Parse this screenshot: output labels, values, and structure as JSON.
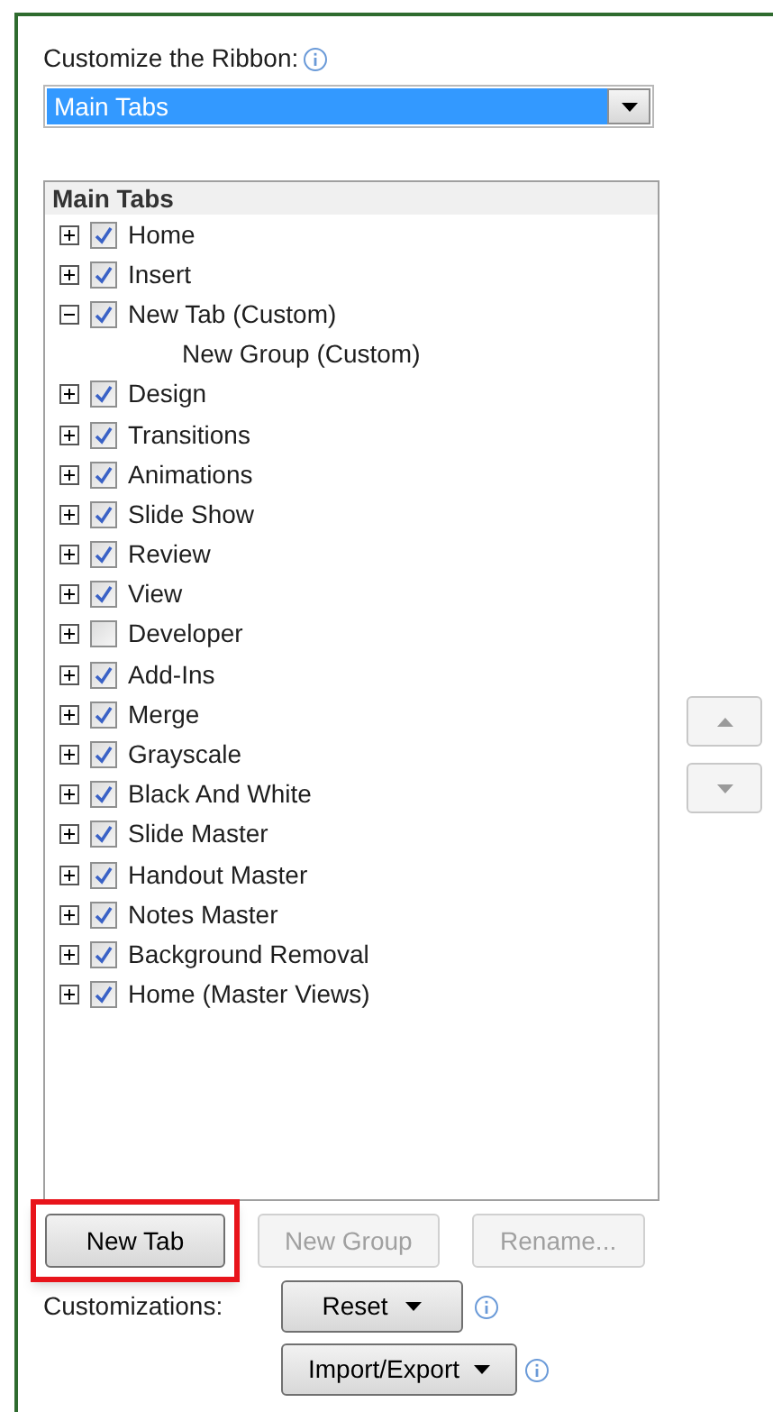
{
  "ribbon_label": "Customize the Ribbon:",
  "ribbon_select": {
    "value": "Main Tabs"
  },
  "tree": {
    "header": "Main Tabs",
    "items": [
      {
        "label": "Home",
        "checked": true,
        "expanded": false
      },
      {
        "label": "Insert",
        "checked": true,
        "expanded": false
      },
      {
        "label": "New Tab (Custom)",
        "checked": true,
        "expanded": true,
        "children": [
          {
            "label": "New Group (Custom)"
          }
        ]
      },
      {
        "label": "Design",
        "checked": true,
        "expanded": false
      },
      {
        "label": "Transitions",
        "checked": true,
        "expanded": false
      },
      {
        "label": "Animations",
        "checked": true,
        "expanded": false
      },
      {
        "label": "Slide Show",
        "checked": true,
        "expanded": false
      },
      {
        "label": "Review",
        "checked": true,
        "expanded": false
      },
      {
        "label": "View",
        "checked": true,
        "expanded": false
      },
      {
        "label": "Developer",
        "checked": false,
        "expanded": false
      },
      {
        "label": "Add-Ins",
        "checked": true,
        "expanded": false
      },
      {
        "label": "Merge",
        "checked": true,
        "expanded": false
      },
      {
        "label": "Grayscale",
        "checked": true,
        "expanded": false
      },
      {
        "label": "Black And White",
        "checked": true,
        "expanded": false
      },
      {
        "label": "Slide Master",
        "checked": true,
        "expanded": false
      },
      {
        "label": "Handout Master",
        "checked": true,
        "expanded": false
      },
      {
        "label": "Notes Master",
        "checked": true,
        "expanded": false
      },
      {
        "label": "Background Removal",
        "checked": true,
        "expanded": false
      },
      {
        "label": "Home (Master Views)",
        "checked": true,
        "expanded": false
      }
    ]
  },
  "action_buttons": [
    {
      "label": "New Tab",
      "disabled": false,
      "highlighted": true
    },
    {
      "label": "New Group",
      "disabled": true,
      "highlighted": false
    },
    {
      "label": "Rename...",
      "disabled": true,
      "highlighted": false
    }
  ],
  "customizations_label": "Customizations:",
  "reset_button": "Reset",
  "import_export_button": "Import/Export"
}
